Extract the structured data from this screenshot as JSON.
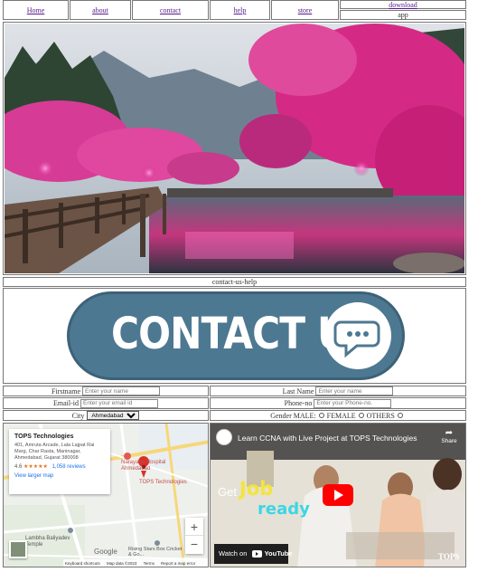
{
  "nav": {
    "home": "Home",
    "about": "about",
    "contact": "contact",
    "help": "help",
    "store": "store",
    "download": "download",
    "app": "app"
  },
  "section_label": "contact-us-help",
  "banner": {
    "text": "CONTACT US",
    "color": "#4d7891"
  },
  "form": {
    "firstname_label": "Firstname",
    "firstname_placeholder": "Enter your name",
    "lastname_label": "Last Name",
    "lastname_placeholder": "Enter your name",
    "email_label": "Email-id",
    "email_placeholder": "Enter your email id",
    "phone_label": "Phone-no",
    "phone_placeholder": "Enter your Phone-no.",
    "city_label": "City",
    "city_value": "Ahmedabad",
    "gender_label": "Gender MALE:",
    "female_label": "FEMALE",
    "others_label": "OTHERS"
  },
  "map": {
    "place_name": "TOPS Technologies",
    "address": "401, Amrutа Arcade, Lala Lajpat Rai Marg, Char Rasta, Maninagar, Ahmedabad, Gujarat 380008",
    "rating": "4.6",
    "stars": "★★★★★",
    "reviews": "1,058 reviews",
    "view_larger": "View larger map",
    "label_hospital": "Narayana Hospital Ahmedabad",
    "label_marker": "TOPS Technologies",
    "label_temple": "Lambha Baliyadev Temple",
    "label_stars": "Rising Stars Box Cricket & Go...",
    "zoom_in": "+",
    "zoom_out": "−",
    "footer_google": "Google",
    "footer_shortcuts": "Keyboard shortcuts",
    "footer_mapdata": "Map data ©2023",
    "footer_terms": "Terms",
    "footer_report": "Report a map error"
  },
  "video": {
    "title": "Learn CCNA with Live Project at TOPS Technologies",
    "share": "Share",
    "get": "Get",
    "job": "Job",
    "ready": "ready",
    "watch_on": "Watch on",
    "youtube": "YouTube",
    "brand": "TOPS"
  }
}
